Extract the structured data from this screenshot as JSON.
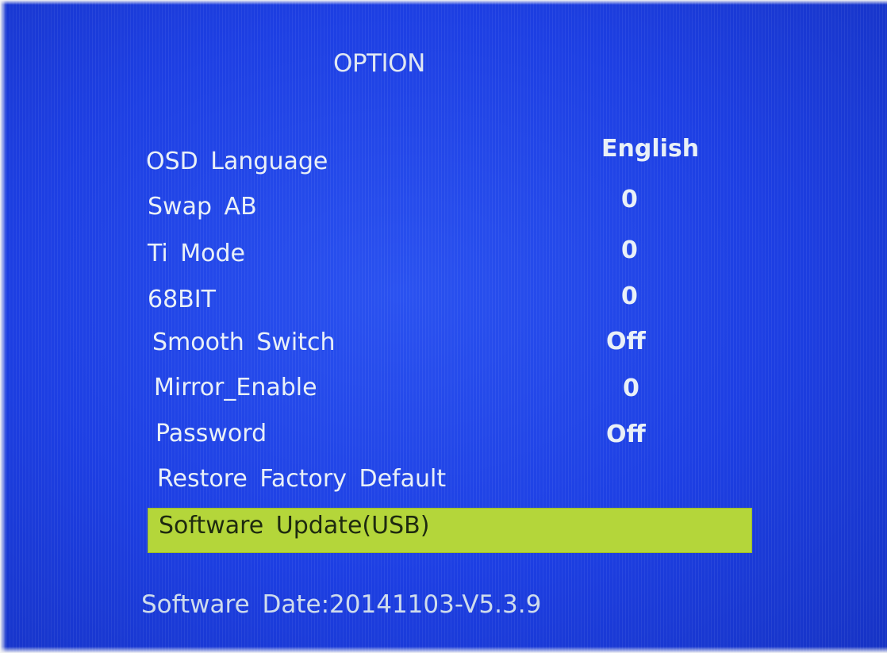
{
  "menu": {
    "title": "OPTION",
    "items": [
      {
        "label": "OSD Language",
        "value": "English"
      },
      {
        "label": "Swap AB",
        "value": "0"
      },
      {
        "label": "Ti Mode",
        "value": "0"
      },
      {
        "label": "68BIT",
        "value": "0"
      },
      {
        "label": "Smooth Switch",
        "value": "Off"
      },
      {
        "label": "Mirror_Enable",
        "value": "0"
      },
      {
        "label": "Password",
        "value": "Off"
      },
      {
        "label": "Restore Factory Default",
        "value": ""
      },
      {
        "label": "Software Update(USB)",
        "value": ""
      }
    ],
    "selected_item": "Software Update(USB)"
  },
  "footer": {
    "software_date": "Software Date:20141103-V5.3.9"
  },
  "colors": {
    "background": "#1d3fe3",
    "text": "#e9f0f7",
    "highlight": "#b4d63a"
  }
}
